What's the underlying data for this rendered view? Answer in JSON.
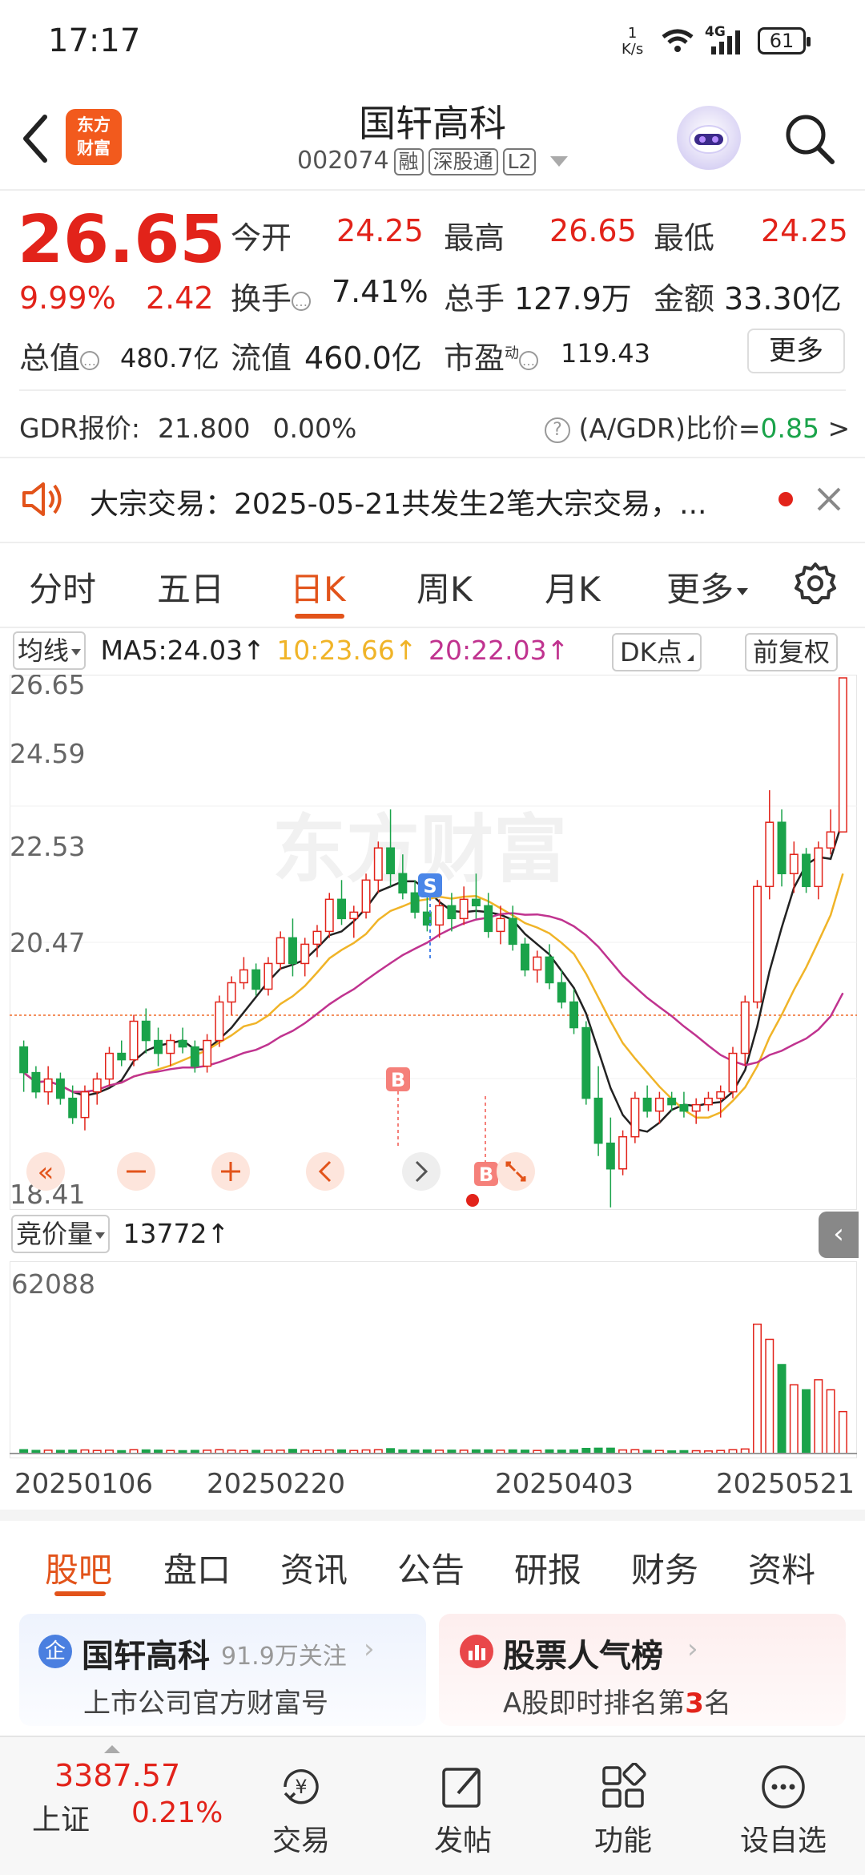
{
  "status": {
    "time": "17:17",
    "net_speed": "1",
    "net_unit": "K/s",
    "signal": "4G",
    "battery": "61"
  },
  "header": {
    "logo_line1": "东方",
    "logo_line2": "财富",
    "stock_name": "国轩高科",
    "stock_code": "002074",
    "tags": [
      "融",
      "深股通",
      "L2"
    ]
  },
  "quote": {
    "price": "26.65",
    "change_pct": "9.99%",
    "change_amt": "2.42",
    "open_label": "今开",
    "open": "24.25",
    "high_label": "最高",
    "high": "26.65",
    "low_label": "最低",
    "low": "24.25",
    "turnover_label": "换手",
    "turnover": "7.41%",
    "volume_label": "总手",
    "volume": "127.9万",
    "amount_label": "金额",
    "amount": "33.30亿",
    "mktcap_label": "总值",
    "mktcap": "480.7亿",
    "float_label": "流值",
    "float_cap": "460.0亿",
    "pe_label": "市盈",
    "pe_sup": "动",
    "pe": "119.43",
    "more_button": "更多"
  },
  "gdr": {
    "label": "GDR报价:",
    "price": "21.800",
    "change": "0.00%",
    "ratio_label": "(A/GDR)比价=",
    "ratio": "0.85",
    "arrow": ">"
  },
  "notice": {
    "text": "大宗交易：2025-05-21共发生2笔大宗交易，..."
  },
  "period_tabs": [
    "分时",
    "五日",
    "日K",
    "周K",
    "月K",
    "更多"
  ],
  "active_period": "日K",
  "indicators": {
    "ma_select": "均线",
    "ma5": "MA5:24.03↑",
    "ma10": "10:23.66↑",
    "ma20": "20:22.03↑",
    "dk_button": "DK点",
    "fuquan_button": "前复权",
    "ma_colors": {
      "ma5": "#222222",
      "ma10": "#f0b428",
      "ma20": "#c0338f"
    }
  },
  "kchart": {
    "y_labels": [
      "26.65",
      "24.59",
      "22.53",
      "20.47",
      "18.41"
    ],
    "ylim": [
      18.41,
      26.65
    ],
    "marker_b": "B",
    "marker_s": "S"
  },
  "volume": {
    "select": "竞价量",
    "value": "13772↑",
    "max_label": "62088"
  },
  "date_axis": [
    "20250106",
    "20250220",
    "20250403",
    "20250521"
  ],
  "bottom_tabs": [
    "股吧",
    "盘口",
    "资讯",
    "公告",
    "研报",
    "财务",
    "资料"
  ],
  "card1": {
    "badge": "企",
    "title": "国轩高科",
    "followers": "91.9万关注",
    "subtitle": "上市公司官方财富号"
  },
  "card2": {
    "title": "股票人气榜",
    "subtitle_pre": "A股即时排名第",
    "rank": "3",
    "subtitle_post": "名"
  },
  "bottom_nav": {
    "index_value": "3387.57",
    "index_name": "上证",
    "index_change": "0.21%",
    "items": [
      "交易",
      "发帖",
      "功能",
      "设自选"
    ]
  },
  "chart_data": {
    "type": "candlestick",
    "ylim": [
      18.41,
      26.65
    ],
    "x_ticks": [
      "20250106",
      "20250220",
      "20250403",
      "20250521"
    ],
    "candles": [
      [
        20.9,
        21.0,
        20.2,
        20.5
      ],
      [
        20.5,
        20.6,
        20.1,
        20.2
      ],
      [
        20.2,
        20.6,
        20.0,
        20.4
      ],
      [
        20.4,
        20.5,
        20.0,
        20.1
      ],
      [
        20.1,
        20.3,
        19.7,
        19.8
      ],
      [
        19.8,
        20.3,
        19.6,
        20.2
      ],
      [
        20.2,
        20.5,
        20.0,
        20.4
      ],
      [
        20.4,
        20.9,
        20.3,
        20.8
      ],
      [
        20.8,
        21.0,
        20.6,
        20.7
      ],
      [
        20.7,
        21.4,
        20.6,
        21.3
      ],
      [
        21.3,
        21.5,
        20.8,
        21.0
      ],
      [
        21.0,
        21.2,
        20.6,
        20.8
      ],
      [
        20.8,
        21.1,
        20.6,
        21.0
      ],
      [
        21.0,
        21.2,
        20.8,
        20.9
      ],
      [
        20.9,
        21.0,
        20.5,
        20.6
      ],
      [
        20.6,
        21.1,
        20.5,
        21.0
      ],
      [
        21.0,
        21.7,
        20.9,
        21.6
      ],
      [
        21.6,
        22.0,
        21.4,
        21.9
      ],
      [
        21.9,
        22.3,
        21.8,
        22.1
      ],
      [
        22.1,
        22.2,
        21.7,
        21.8
      ],
      [
        21.8,
        22.3,
        21.7,
        22.2
      ],
      [
        22.2,
        22.7,
        22.1,
        22.6
      ],
      [
        22.6,
        22.9,
        22.0,
        22.2
      ],
      [
        22.2,
        22.6,
        22.0,
        22.5
      ],
      [
        22.5,
        22.8,
        22.3,
        22.7
      ],
      [
        22.7,
        23.3,
        22.6,
        23.2
      ],
      [
        23.2,
        23.5,
        22.8,
        22.9
      ],
      [
        22.9,
        23.1,
        22.6,
        23.0
      ],
      [
        23.0,
        23.6,
        22.9,
        23.5
      ],
      [
        23.5,
        24.1,
        23.3,
        24.0
      ],
      [
        24.0,
        24.6,
        23.4,
        23.6
      ],
      [
        23.6,
        23.9,
        23.2,
        23.3
      ],
      [
        23.3,
        23.5,
        22.9,
        23.0
      ],
      [
        23.0,
        23.4,
        22.7,
        22.8
      ],
      [
        22.8,
        23.2,
        22.6,
        23.1
      ],
      [
        23.1,
        23.3,
        22.7,
        22.9
      ],
      [
        22.9,
        23.4,
        22.8,
        23.2
      ],
      [
        23.2,
        23.6,
        22.9,
        23.1
      ],
      [
        23.1,
        23.3,
        22.6,
        22.7
      ],
      [
        22.7,
        23.1,
        22.5,
        22.9
      ],
      [
        22.9,
        23.1,
        22.4,
        22.5
      ],
      [
        22.5,
        22.6,
        22.0,
        22.1
      ],
      [
        22.1,
        22.4,
        21.9,
        22.3
      ],
      [
        22.3,
        22.5,
        21.8,
        21.9
      ],
      [
        21.9,
        22.1,
        21.5,
        21.6
      ],
      [
        21.6,
        21.8,
        21.1,
        21.2
      ],
      [
        21.2,
        21.3,
        20.0,
        20.1
      ],
      [
        20.1,
        20.6,
        19.2,
        19.4
      ],
      [
        19.4,
        19.8,
        18.4,
        19.0
      ],
      [
        19.0,
        19.6,
        18.9,
        19.5
      ],
      [
        19.5,
        20.2,
        19.4,
        20.1
      ],
      [
        20.1,
        20.3,
        19.8,
        19.9
      ],
      [
        19.9,
        20.2,
        19.7,
        20.1
      ],
      [
        20.1,
        20.2,
        19.9,
        20.0
      ],
      [
        20.0,
        20.2,
        19.8,
        19.9
      ],
      [
        19.9,
        20.1,
        19.7,
        20.0
      ],
      [
        20.0,
        20.2,
        19.9,
        20.1
      ],
      [
        20.1,
        20.3,
        19.8,
        20.2
      ],
      [
        20.2,
        20.9,
        20.1,
        20.8
      ],
      [
        20.8,
        21.7,
        20.6,
        21.6
      ],
      [
        21.6,
        23.5,
        21.5,
        23.4
      ],
      [
        23.4,
        24.9,
        23.2,
        24.4
      ],
      [
        24.4,
        24.6,
        23.4,
        23.6
      ],
      [
        23.6,
        24.1,
        23.3,
        23.9
      ],
      [
        23.9,
        24.0,
        23.3,
        23.4
      ],
      [
        23.4,
        24.1,
        23.2,
        24.0
      ],
      [
        24.0,
        24.6,
        23.9,
        24.25
      ],
      [
        24.25,
        26.65,
        24.25,
        26.65
      ]
    ],
    "ma5": {
      "label": "MA5",
      "last": 24.03
    },
    "ma10": {
      "label": "10",
      "last": 23.66
    },
    "ma20": {
      "label": "20",
      "last": 22.03
    },
    "volume": {
      "max": 62088,
      "last": 13772
    }
  }
}
